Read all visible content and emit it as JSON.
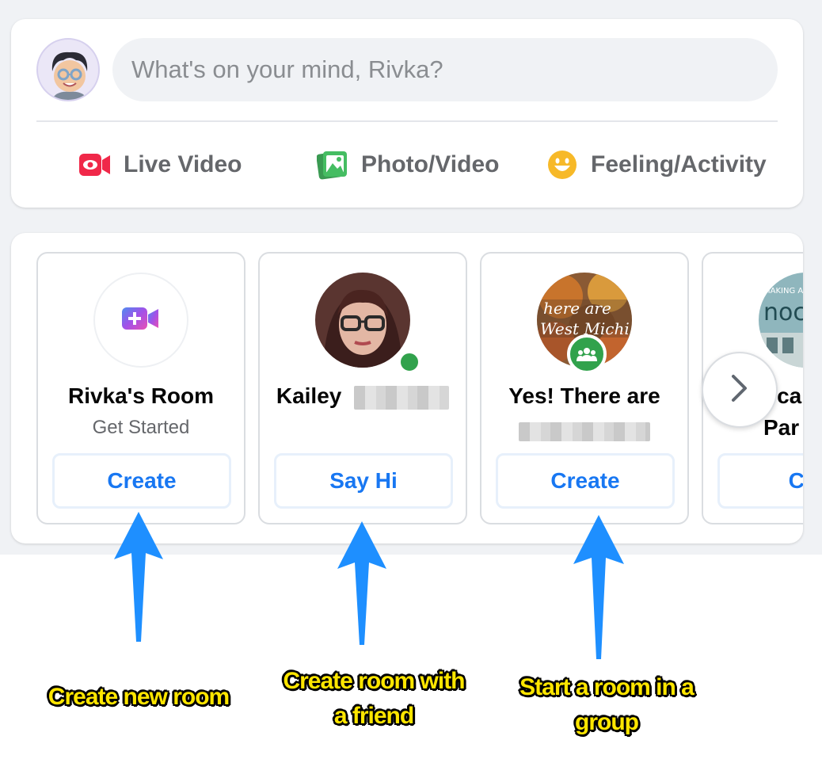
{
  "composer": {
    "placeholder": "What's on your mind, Rivka?",
    "actions": [
      {
        "label": "Live Video",
        "icon": "live-video-icon",
        "color": "#f02849"
      },
      {
        "label": "Photo/Video",
        "icon": "photo-icon",
        "color": "#45bd62"
      },
      {
        "label": "Feeling/Activity",
        "icon": "feeling-icon",
        "color": "#f7b928"
      }
    ]
  },
  "rooms": {
    "tiles": [
      {
        "name": "Rivka's Room",
        "subtitle": "Get Started",
        "button": "Create",
        "icon": "video-plus-icon"
      },
      {
        "name": "Kailey",
        "button": "Say Hi",
        "status": "online"
      },
      {
        "name": "Yes! There are",
        "button": "Create",
        "badge": "group-icon"
      },
      {
        "name": "ocal",
        "subtitle": "Par",
        "button": "Cre"
      }
    ],
    "next_icon": "chevron-right-icon"
  },
  "annotations": [
    {
      "text": "Create new room"
    },
    {
      "text": "Create room with a friend"
    },
    {
      "text": "Start a room in a group"
    }
  ],
  "colors": {
    "accent": "#1877f2",
    "arrow": "#1e8fff",
    "caption_fill": "#ffe600",
    "online": "#31a24c"
  }
}
